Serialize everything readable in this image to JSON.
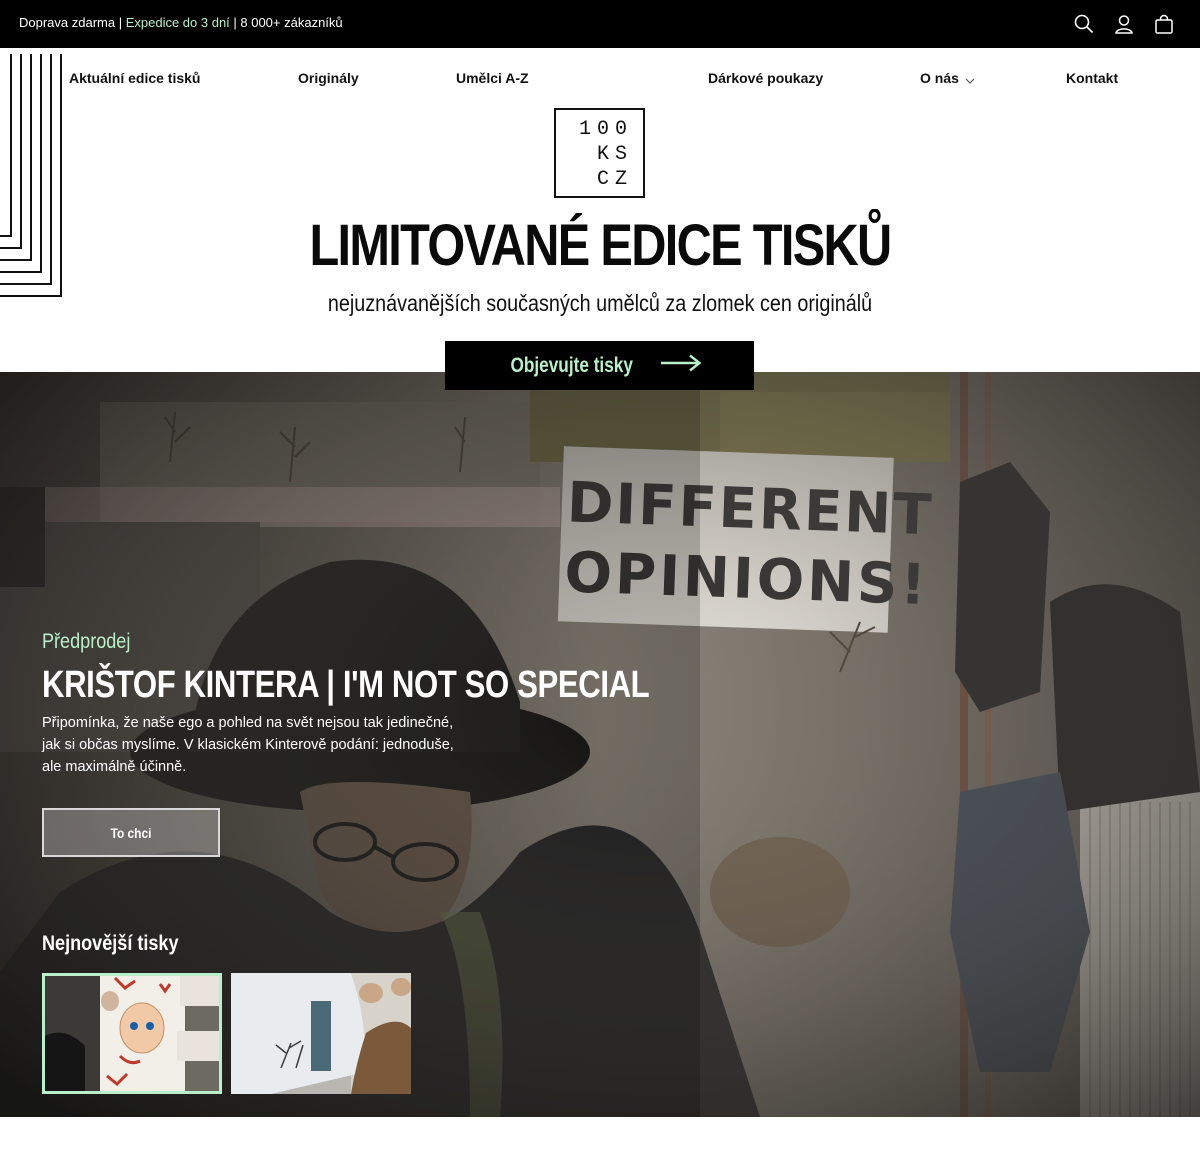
{
  "announcement": {
    "part1": "Doprava zdarma | ",
    "part2": "Expedice do 3 dní",
    "part3": " | 8 000+ zákazníků"
  },
  "header_icons": [
    "search-icon",
    "account-icon",
    "cart-icon"
  ],
  "nav": {
    "items": [
      {
        "label": "Aktuální edice tisků"
      },
      {
        "label": "Originály"
      },
      {
        "label": "Umělci A-Z"
      },
      {
        "label": "Dárkové poukazy"
      },
      {
        "label": "O nás"
      },
      {
        "label": "Kontakt"
      }
    ]
  },
  "logo": {
    "line1": "100",
    "line2": "KS",
    "line3": "CZ"
  },
  "hero": {
    "title": "LIMITOVANÉ EDICE TISKŮ",
    "subtitle": "nejuznávanějších současných umělců za zlomek cen originálů",
    "cta_label": "Objevujte tisky"
  },
  "featured": {
    "badge": "Předprodej",
    "title": "KRIŠTOF KINTERA | I'M NOT SO SPECIAL",
    "description": "Připomínka, že naše ego a pohled na svět nejsou tak jedinečné, jak si občas myslíme. V klasickém Kinterově podání: jednoduše, ale maximálně účinně.",
    "button_label": "To chci"
  },
  "newest": {
    "heading": "Nejnovější tisky"
  },
  "colors": {
    "accent": "#b9f0c9",
    "topbar_bg": "#000000",
    "text": "#111111"
  }
}
